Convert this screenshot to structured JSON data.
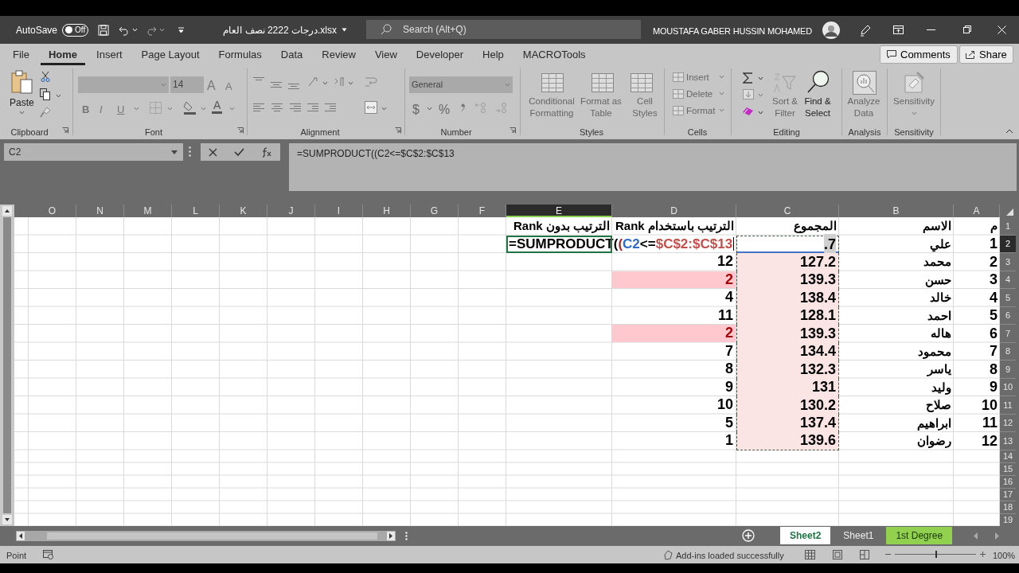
{
  "title_bar": {
    "autosave_label": "AutoSave",
    "autosave_state": "Off",
    "autosave_on": false,
    "file_name": "درجات 2222 نصف العام.xlsx",
    "search_placeholder": "Search (Alt+Q)",
    "user_name": "MOUSTAFA GABER HUSSIN MOHAMED"
  },
  "ribbon_tabs": [
    {
      "label": "File",
      "selected": false
    },
    {
      "label": "Home",
      "selected": true
    },
    {
      "label": "Insert",
      "selected": false
    },
    {
      "label": "Page Layout",
      "selected": false
    },
    {
      "label": "Formulas",
      "selected": false
    },
    {
      "label": "Data",
      "selected": false
    },
    {
      "label": "Review",
      "selected": false
    },
    {
      "label": "View",
      "selected": false
    },
    {
      "label": "Developer",
      "selected": false
    },
    {
      "label": "Help",
      "selected": false
    },
    {
      "label": "MACROTools",
      "selected": false
    }
  ],
  "ribbon_actions": [
    "Comments",
    "Share"
  ],
  "ribbon": {
    "clipboard": {
      "label": "Clipboard",
      "paste": "Paste"
    },
    "font": {
      "label": "Font",
      "size": "14",
      "grow": "A",
      "shrink": "A",
      "styles": [
        "B",
        "I",
        "U"
      ],
      "color_letter": "A"
    },
    "alignment": {
      "label": "Alignment"
    },
    "number": {
      "label": "Number",
      "format": "General",
      "currency": "$",
      "percent": "%"
    },
    "styles": {
      "label": "Styles",
      "buttons": [
        [
          "Conditional",
          "Formatting"
        ],
        [
          "Format as",
          "Table"
        ],
        [
          "Cell",
          "Styles"
        ]
      ]
    },
    "cells": {
      "label": "Cells",
      "buttons": [
        "Insert",
        "Delete",
        "Format"
      ]
    },
    "editing": {
      "label": "Editing",
      "buttons": [
        [
          "Sort &",
          "Filter"
        ],
        [
          "Find &",
          "Select"
        ]
      ]
    },
    "analysis": {
      "label": "Analysis",
      "buttons": [
        [
          "Analyze",
          "Data"
        ]
      ]
    },
    "sensitivity": {
      "label": "Sensitivity",
      "buttons": [
        [
          "Sensitivity"
        ]
      ]
    }
  },
  "formula_bar": {
    "name_box": "C2",
    "formula": "=SUMPRODUCT((C2<=$C$2:$C$13"
  },
  "columns": [
    {
      "label": "O",
      "selected": false
    },
    {
      "label": "N",
      "selected": false
    },
    {
      "label": "M",
      "selected": false
    },
    {
      "label": "L",
      "selected": false
    },
    {
      "label": "K",
      "selected": false
    },
    {
      "label": "J",
      "selected": false
    },
    {
      "label": "I",
      "selected": false
    },
    {
      "label": "H",
      "selected": false
    },
    {
      "label": "G",
      "selected": false
    },
    {
      "label": "F",
      "selected": false
    },
    {
      "label": "E",
      "selected": true
    },
    {
      "label": "D",
      "selected": false
    },
    {
      "label": "C",
      "selected": false
    },
    {
      "label": "B",
      "selected": false
    },
    {
      "label": "A",
      "selected": false
    }
  ],
  "header_row": {
    "row": "1",
    "selected": false,
    "cells": [
      "م",
      "الاسم",
      "المجموع",
      "الترتيب باستخدام Rank",
      "الترتيب بدون Rank"
    ]
  },
  "edit_cell": {
    "segments": [
      {
        "text": "=SUMPRODUCT(",
        "color": "#000000"
      },
      {
        "text": "(",
        "color": "#9c2c2c"
      },
      {
        "text": "C2",
        "color": "#2f6bc0"
      },
      {
        "text": "<=",
        "color": "#000000"
      },
      {
        "text": "$C$2:$C$13",
        "color": "#c0504d"
      }
    ]
  },
  "rows": [
    {
      "total": ".7",
      "total_filled": false,
      "in_range": true,
      "name": "علي",
      "number": "1",
      "row": "2",
      "selected": true
    },
    {
      "rank": "12",
      "duplicate": false,
      "total": "127.2",
      "total_filled": true,
      "in_range": true,
      "name": "محمد",
      "number": "2",
      "row": "3",
      "selected": false
    },
    {
      "rank": "2",
      "duplicate": true,
      "total": "139.3",
      "total_filled": true,
      "in_range": true,
      "name": "حسن",
      "number": "3",
      "row": "4",
      "selected": false
    },
    {
      "rank": "4",
      "duplicate": false,
      "total": "138.4",
      "total_filled": true,
      "in_range": true,
      "name": "خالد",
      "number": "4",
      "row": "5",
      "selected": false
    },
    {
      "rank": "11",
      "duplicate": false,
      "total": "128.1",
      "total_filled": true,
      "in_range": true,
      "name": "احمد",
      "number": "5",
      "row": "6",
      "selected": false
    },
    {
      "rank": "2",
      "duplicate": true,
      "total": "139.3",
      "total_filled": true,
      "in_range": true,
      "name": "هاله",
      "number": "6",
      "row": "7",
      "selected": false
    },
    {
      "rank": "7",
      "duplicate": false,
      "total": "134.4",
      "total_filled": true,
      "in_range": true,
      "name": "محمود",
      "number": "7",
      "row": "8",
      "selected": false
    },
    {
      "rank": "8",
      "duplicate": false,
      "total": "132.3",
      "total_filled": true,
      "in_range": true,
      "name": "ياسر",
      "number": "8",
      "row": "9",
      "selected": false
    },
    {
      "rank": "9",
      "duplicate": false,
      "total": "131",
      "total_filled": true,
      "in_range": true,
      "name": "وليد",
      "number": "9",
      "row": "10",
      "selected": false
    },
    {
      "rank": "10",
      "duplicate": false,
      "total": "130.2",
      "total_filled": true,
      "in_range": true,
      "name": "صلاح",
      "number": "10",
      "row": "11",
      "selected": false
    },
    {
      "rank": "5",
      "duplicate": false,
      "total": "137.4",
      "total_filled": true,
      "in_range": true,
      "name": "ابراهيم",
      "number": "11",
      "row": "12",
      "selected": false
    },
    {
      "rank": "1",
      "duplicate": false,
      "total": "139.6",
      "total_filled": true,
      "in_range": true,
      "name": "رضوان",
      "number": "12",
      "row": "13",
      "selected": false
    }
  ],
  "empty_rows": [
    {
      "row": "14",
      "selected": false
    },
    {
      "row": "15",
      "selected": false
    },
    {
      "row": "16",
      "selected": false
    },
    {
      "row": "17",
      "selected": false
    },
    {
      "row": "18",
      "selected": false
    },
    {
      "row": "19",
      "selected": false
    }
  ],
  "sheet_tabs": [
    {
      "label": "Sheet2",
      "selected": true
    },
    {
      "label": "Sheet1",
      "selected": false
    },
    {
      "label": "1st Degree",
      "selected": false,
      "color": "#92d050"
    }
  ],
  "status_bar": {
    "mode": "Point",
    "message": "Add-ins loaded successfully",
    "zoom_slider": {
      "level": 0.5
    },
    "zoom": "100%"
  }
}
